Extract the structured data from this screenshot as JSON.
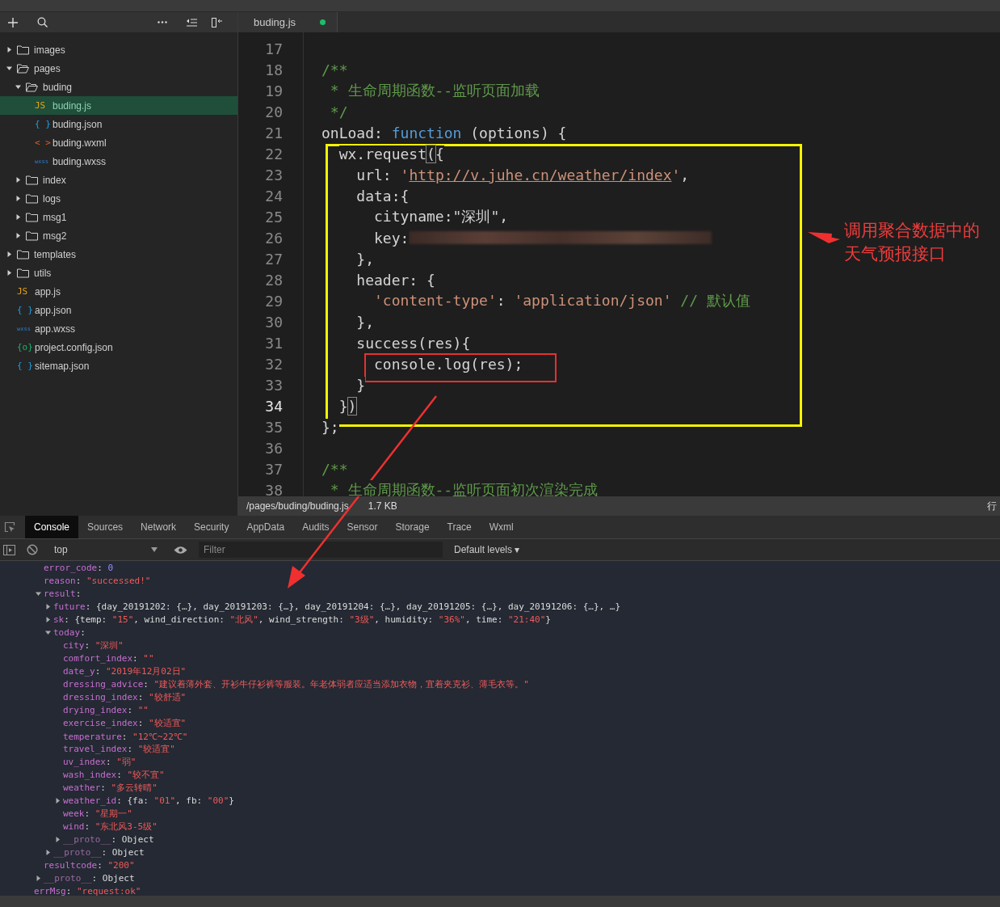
{
  "sidebar": {
    "tree": [
      {
        "name": "images",
        "kind": "folder",
        "expanded": false,
        "selected": false
      },
      {
        "name": "pages",
        "kind": "folder",
        "expanded": true,
        "selected": false,
        "children": [
          {
            "name": "buding",
            "kind": "folder",
            "expanded": true,
            "selected": false,
            "children": [
              {
                "name": "buding.js",
                "kind": "js",
                "badge": "JS",
                "selected": true
              },
              {
                "name": "buding.json",
                "kind": "json",
                "badge": "{ }",
                "selected": false
              },
              {
                "name": "buding.wxml",
                "kind": "wxml",
                "badge": "< >",
                "selected": false
              },
              {
                "name": "buding.wxss",
                "kind": "wxss",
                "badge": "wxss",
                "selected": false
              }
            ]
          },
          {
            "name": "index",
            "kind": "folder",
            "expanded": false,
            "selected": false
          },
          {
            "name": "logs",
            "kind": "folder",
            "expanded": false,
            "selected": false
          },
          {
            "name": "msg1",
            "kind": "folder",
            "expanded": false,
            "selected": false
          },
          {
            "name": "msg2",
            "kind": "folder",
            "expanded": false,
            "selected": false
          }
        ]
      },
      {
        "name": "templates",
        "kind": "folder",
        "expanded": false,
        "selected": false
      },
      {
        "name": "utils",
        "kind": "folder",
        "expanded": false,
        "selected": false
      },
      {
        "name": "app.js",
        "kind": "js",
        "badge": "JS",
        "selected": false
      },
      {
        "name": "app.json",
        "kind": "json",
        "badge": "{ }",
        "selected": false
      },
      {
        "name": "app.wxss",
        "kind": "wxss",
        "badge": "wxss",
        "selected": false
      },
      {
        "name": "project.config.json",
        "kind": "config",
        "badge": "{o}",
        "selected": false
      },
      {
        "name": "sitemap.json",
        "kind": "json",
        "badge": "{ }",
        "selected": false
      }
    ]
  },
  "editor": {
    "tabs": [
      {
        "label": "buding.js",
        "modified": true,
        "selected": true
      }
    ],
    "lines": [
      {
        "number": "17",
        "current": false
      },
      {
        "number": "18",
        "current": false,
        "tokens": [
          {
            "kind": "comment",
            "text": "/**"
          }
        ]
      },
      {
        "number": "19",
        "current": false,
        "tokens": [
          {
            "kind": "comment",
            "text": " * 生命周期函数--监听页面加载"
          }
        ]
      },
      {
        "number": "20",
        "current": false,
        "tokens": [
          {
            "kind": "comment",
            "text": " */"
          }
        ]
      },
      {
        "number": "21",
        "current": false,
        "tokens": [
          {
            "kind": "plain",
            "text": "onLoad: "
          },
          {
            "kind": "keyword",
            "text": "function"
          },
          {
            "kind": "plain",
            "text": " (options) {"
          }
        ],
        "children": [
          {
            "number": "22",
            "current": false,
            "tokens": [
              {
                "kind": "plain",
                "text": "wx.request"
              },
              {
                "kind": "match",
                "text": "("
              },
              {
                "kind": "plain",
                "text": "{"
              }
            ],
            "children": [
              {
                "number": "23",
                "current": false,
                "tokens": [
                  {
                    "kind": "plain",
                    "text": "url: "
                  },
                  {
                    "kind": "string",
                    "text": "'"
                  },
                  {
                    "kind": "url",
                    "text": "http://v.juhe.cn/weather/index"
                  },
                  {
                    "kind": "string",
                    "text": "'"
                  },
                  {
                    "kind": "plain",
                    "text": ","
                  }
                ]
              },
              {
                "number": "24",
                "current": false,
                "tokens": [
                  {
                    "kind": "plain",
                    "text": "data:{"
                  }
                ],
                "children": [
                  {
                    "number": "25",
                    "current": false,
                    "tokens": [
                      {
                        "kind": "plain",
                        "text": "cityname:\"深圳\","
                      }
                    ]
                  },
                  {
                    "number": "26",
                    "current": false,
                    "redacted": true,
                    "tokens": [
                      {
                        "kind": "plain",
                        "text": "key:"
                      }
                    ]
                  }
                ]
              },
              {
                "number": "27",
                "current": false,
                "tokens": [
                  {
                    "kind": "plain",
                    "text": "},"
                  }
                ]
              },
              {
                "number": "28",
                "current": false,
                "tokens": [
                  {
                    "kind": "plain",
                    "text": "header: {"
                  }
                ],
                "children": [
                  {
                    "number": "29",
                    "current": false,
                    "tokens": [
                      {
                        "kind": "string",
                        "text": "'content-type'"
                      },
                      {
                        "kind": "plain",
                        "text": ": "
                      },
                      {
                        "kind": "string",
                        "text": "'application/json'"
                      },
                      {
                        "kind": "comment",
                        "text": " // 默认值"
                      }
                    ]
                  }
                ]
              },
              {
                "number": "30",
                "current": false,
                "tokens": [
                  {
                    "kind": "plain",
                    "text": "},"
                  }
                ]
              },
              {
                "number": "31",
                "current": false,
                "tokens": [
                  {
                    "kind": "plain",
                    "text": "success(res){"
                  }
                ],
                "children": [
                  {
                    "number": "32",
                    "current": false,
                    "tokens": [
                      {
                        "kind": "plain",
                        "text": "console.log(res);"
                      }
                    ]
                  }
                ]
              },
              {
                "number": "33",
                "current": false,
                "tokens": [
                  {
                    "kind": "plain",
                    "text": "}"
                  }
                ]
              }
            ]
          },
          {
            "number": "34",
            "current": true,
            "tokens": [
              {
                "kind": "plain",
                "text": "}"
              },
              {
                "kind": "match",
                "text": ")"
              }
            ]
          }
        ]
      },
      {
        "number": "35",
        "current": false,
        "tokens": [
          {
            "kind": "plain",
            "text": "};"
          }
        ]
      },
      {
        "number": "36",
        "current": false
      },
      {
        "number": "37",
        "current": false,
        "tokens": [
          {
            "kind": "comment",
            "text": "/**"
          }
        ]
      },
      {
        "number": "38",
        "current": false,
        "tokens": [
          {
            "kind": "comment",
            "text": " * 生命周期函数--监听页面初次渲染完成"
          }
        ]
      }
    ],
    "status_bar": {
      "path": "/pages/buding/buding.js",
      "size": "1.7 KB",
      "position": "行"
    }
  },
  "annotation": {
    "text": "调用聚合数据中的天气预报接口"
  },
  "devtools": {
    "tabs": [
      {
        "label": "Console",
        "selected": true
      },
      {
        "label": "Sources",
        "selected": false
      },
      {
        "label": "Network",
        "selected": false
      },
      {
        "label": "Security",
        "selected": false
      },
      {
        "label": "AppData",
        "selected": false
      },
      {
        "label": "Audits",
        "selected": false
      },
      {
        "label": "Sensor",
        "selected": false
      },
      {
        "label": "Storage",
        "selected": false
      },
      {
        "label": "Trace",
        "selected": false
      },
      {
        "label": "Wxml",
        "selected": false
      }
    ],
    "context": "top",
    "filter": {
      "placeholder": "Filter"
    },
    "levels": "Default levels ▾"
  },
  "console_output": {
    "object_fields": [
      {
        "key": "error_code",
        "kind": "field",
        "value": [
          {
            "kind": "plain",
            "text": ": "
          },
          {
            "kind": "num",
            "text": "0"
          }
        ]
      },
      {
        "key": "reason",
        "kind": "field",
        "value": [
          {
            "kind": "plain",
            "text": ": "
          },
          {
            "kind": "str",
            "text": "\"successed!\""
          }
        ]
      },
      {
        "key": "result",
        "kind": "field",
        "expanded": true,
        "value": [
          {
            "kind": "plain",
            "text": ":"
          }
        ],
        "children": [
          {
            "key": "future",
            "kind": "field",
            "expanded": false,
            "value": [
              {
                "kind": "plain",
                "text": ": {day_20191202: {…}, day_20191203: {…}, day_20191204: {…}, day_20191205: {…}, day_20191206: {…}, …}"
              }
            ]
          },
          {
            "key": "sk",
            "kind": "field",
            "expanded": false,
            "value": [
              {
                "kind": "plain",
                "text": ": {temp: "
              },
              {
                "kind": "str",
                "text": "\"15\""
              },
              {
                "kind": "plain",
                "text": ", wind_direction: "
              },
              {
                "kind": "str",
                "text": "\"北风\""
              },
              {
                "kind": "plain",
                "text": ", wind_strength: "
              },
              {
                "kind": "str",
                "text": "\"3级\""
              },
              {
                "kind": "plain",
                "text": ", humidity: "
              },
              {
                "kind": "str",
                "text": "\"36%\""
              },
              {
                "kind": "plain",
                "text": ", time: "
              },
              {
                "kind": "str",
                "text": "\"21:40\""
              },
              {
                "kind": "plain",
                "text": "}"
              }
            ]
          },
          {
            "key": "today",
            "kind": "field",
            "expanded": true,
            "value": [
              {
                "kind": "plain",
                "text": ":"
              }
            ],
            "children": [
              {
                "key": "city",
                "kind": "field",
                "value": [
                  {
                    "kind": "plain",
                    "text": ": "
                  },
                  {
                    "kind": "str",
                    "text": "\"深圳\""
                  }
                ]
              },
              {
                "key": "comfort_index",
                "kind": "field",
                "value": [
                  {
                    "kind": "plain",
                    "text": ": "
                  },
                  {
                    "kind": "str",
                    "text": "\"\""
                  }
                ]
              },
              {
                "key": "date_y",
                "kind": "field",
                "value": [
                  {
                    "kind": "plain",
                    "text": ": "
                  },
                  {
                    "kind": "str",
                    "text": "\"2019年12月02日\""
                  }
                ]
              },
              {
                "key": "dressing_advice",
                "kind": "field",
                "value": [
                  {
                    "kind": "plain",
                    "text": ": "
                  },
                  {
                    "kind": "str",
                    "text": "\"建议着薄外套、开衫牛仔衫裤等服装。年老体弱者应适当添加衣物，宜着夹克衫、薄毛衣等。\""
                  }
                ]
              },
              {
                "key": "dressing_index",
                "kind": "field",
                "value": [
                  {
                    "kind": "plain",
                    "text": ": "
                  },
                  {
                    "kind": "str",
                    "text": "\"较舒适\""
                  }
                ]
              },
              {
                "key": "drying_index",
                "kind": "field",
                "value": [
                  {
                    "kind": "plain",
                    "text": ": "
                  },
                  {
                    "kind": "str",
                    "text": "\"\""
                  }
                ]
              },
              {
                "key": "exercise_index",
                "kind": "field",
                "value": [
                  {
                    "kind": "plain",
                    "text": ": "
                  },
                  {
                    "kind": "str",
                    "text": "\"较适宜\""
                  }
                ]
              },
              {
                "key": "temperature",
                "kind": "field",
                "value": [
                  {
                    "kind": "plain",
                    "text": ": "
                  },
                  {
                    "kind": "str",
                    "text": "\"12℃~22℃\""
                  }
                ]
              },
              {
                "key": "travel_index",
                "kind": "field",
                "value": [
                  {
                    "kind": "plain",
                    "text": ": "
                  },
                  {
                    "kind": "str",
                    "text": "\"较适宜\""
                  }
                ]
              },
              {
                "key": "uv_index",
                "kind": "field",
                "value": [
                  {
                    "kind": "plain",
                    "text": ": "
                  },
                  {
                    "kind": "str",
                    "text": "\"弱\""
                  }
                ]
              },
              {
                "key": "wash_index",
                "kind": "field",
                "value": [
                  {
                    "kind": "plain",
                    "text": ": "
                  },
                  {
                    "kind": "str",
                    "text": "\"较不宜\""
                  }
                ]
              },
              {
                "key": "weather",
                "kind": "field",
                "value": [
                  {
                    "kind": "plain",
                    "text": ": "
                  },
                  {
                    "kind": "str",
                    "text": "\"多云转晴\""
                  }
                ]
              },
              {
                "key": "weather_id",
                "kind": "field",
                "expanded": false,
                "value": [
                  {
                    "kind": "plain",
                    "text": ": {fa: "
                  },
                  {
                    "kind": "str",
                    "text": "\"01\""
                  },
                  {
                    "kind": "plain",
                    "text": ", fb: "
                  },
                  {
                    "kind": "str",
                    "text": "\"00\""
                  },
                  {
                    "kind": "plain",
                    "text": "}"
                  }
                ]
              },
              {
                "key": "week",
                "kind": "field",
                "value": [
                  {
                    "kind": "plain",
                    "text": ": "
                  },
                  {
                    "kind": "str",
                    "text": "\"星期一\""
                  }
                ]
              },
              {
                "key": "wind",
                "kind": "field",
                "value": [
                  {
                    "kind": "plain",
                    "text": ": "
                  },
                  {
                    "kind": "str",
                    "text": "\"东北风3-5级\""
                  }
                ]
              },
              {
                "key": "__proto__",
                "kind": "proto",
                "expanded": false,
                "value": [
                  {
                    "kind": "plain",
                    "text": ": Object"
                  }
                ]
              }
            ]
          },
          {
            "key": "__proto__",
            "kind": "proto",
            "expanded": false,
            "value": [
              {
                "kind": "plain",
                "text": ": Object"
              }
            ]
          }
        ]
      },
      {
        "key": "resultcode",
        "kind": "field",
        "value": [
          {
            "kind": "plain",
            "text": ": "
          },
          {
            "kind": "str",
            "text": "\"200\""
          }
        ]
      },
      {
        "key": "__proto__",
        "kind": "proto",
        "expanded": false,
        "value": [
          {
            "kind": "plain",
            "text": ": Object"
          }
        ]
      }
    ],
    "trailing_fields": [
      {
        "key": "errMsg",
        "kind": "field",
        "value": [
          {
            "kind": "plain",
            "text": ": "
          },
          {
            "kind": "str",
            "text": "\"request:ok\""
          }
        ]
      }
    ]
  }
}
